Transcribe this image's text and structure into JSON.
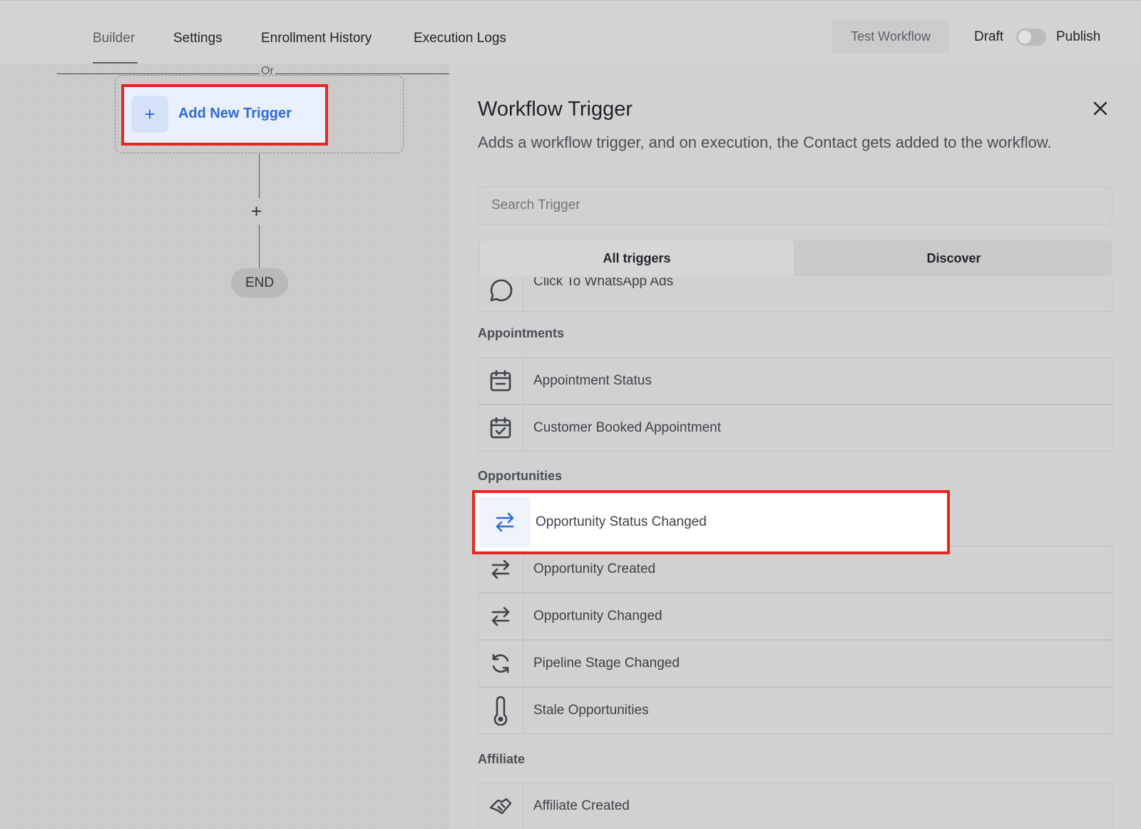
{
  "header": {
    "tabs": [
      {
        "label": "Builder",
        "active": true
      },
      {
        "label": "Settings"
      },
      {
        "label": "Enrollment History"
      },
      {
        "label": "Execution Logs"
      }
    ],
    "test_workflow": "Test Workflow",
    "draft_label": "Draft",
    "publish_label": "Publish",
    "publish_toggle_on": false
  },
  "canvas": {
    "or_label": "Or",
    "add_trigger_label": "Add New Trigger",
    "add_step_glyph": "+",
    "end_label": "END"
  },
  "panel": {
    "title": "Workflow Trigger",
    "subtitle": "Adds a workflow trigger, and on execution, the Contact gets added to the workflow.",
    "search_placeholder": "Search Trigger",
    "segments": [
      "All triggers",
      "Discover"
    ],
    "partial_item": {
      "label": "Click To WhatsApp Ads",
      "icon": "whatsapp-icon"
    },
    "sections": [
      {
        "title": "Appointments",
        "items": [
          {
            "label": "Appointment Status",
            "icon": "calendar-icon"
          },
          {
            "label": "Customer Booked Appointment",
            "icon": "calendar-check-icon"
          }
        ]
      },
      {
        "title": "Opportunities",
        "items": [
          {
            "label": "Opportunity Status Changed",
            "icon": "arrows-exchange-icon",
            "highlighted": true
          },
          {
            "label": "Opportunity Created",
            "icon": "arrows-exchange-icon"
          },
          {
            "label": "Opportunity Changed",
            "icon": "arrows-exchange-icon"
          },
          {
            "label": "Pipeline Stage Changed",
            "icon": "refresh-icon"
          },
          {
            "label": "Stale Opportunities",
            "icon": "thermometer-icon"
          }
        ]
      },
      {
        "title": "Affiliate",
        "items": [
          {
            "label": "Affiliate Created",
            "icon": "handshake-icon"
          }
        ]
      }
    ]
  },
  "colors": {
    "accent": "#2f6bd9",
    "highlight_border": "#e02a1f"
  }
}
